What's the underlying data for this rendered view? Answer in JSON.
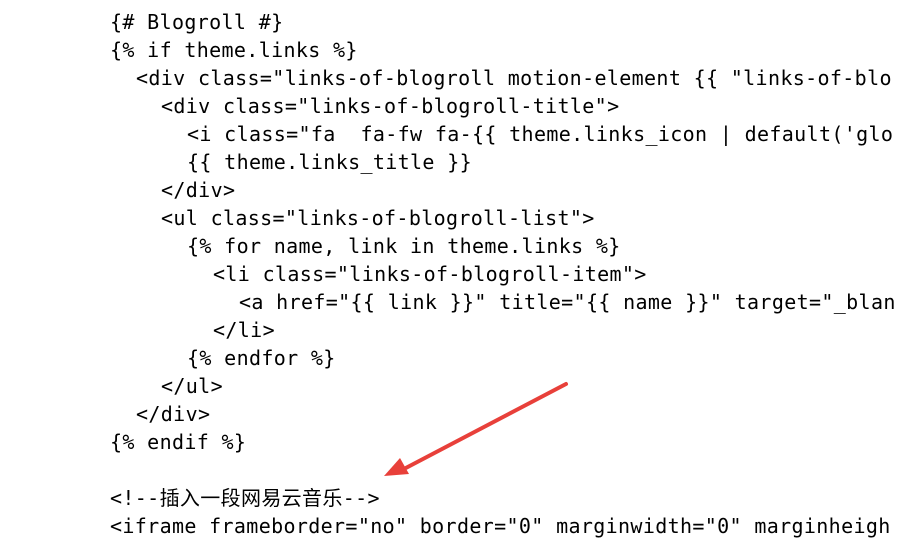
{
  "editor": {
    "lines": [
      {
        "indent": 0,
        "text": "{# Blogroll #}"
      },
      {
        "indent": 0,
        "text": "{% if theme.links %}"
      },
      {
        "indent": 1,
        "text": "<div class=\"links-of-blogroll motion-element {{ \"links-of-blo"
      },
      {
        "indent": 2,
        "text": "<div class=\"links-of-blogroll-title\">"
      },
      {
        "indent": 3,
        "text": "<i class=\"fa  fa-fw fa-{{ theme.links_icon | default('glo"
      },
      {
        "indent": 3,
        "text": "{{ theme.links_title }}"
      },
      {
        "indent": 2,
        "text": "</div>"
      },
      {
        "indent": 2,
        "text": "<ul class=\"links-of-blogroll-list\">"
      },
      {
        "indent": 3,
        "text": "{% for name, link in theme.links %}"
      },
      {
        "indent": 4,
        "text": "<li class=\"links-of-blogroll-item\">"
      },
      {
        "indent": 5,
        "text": "<a href=\"{{ link }}\" title=\"{{ name }}\" target=\"_blan"
      },
      {
        "indent": 4,
        "text": "</li>"
      },
      {
        "indent": 3,
        "text": "{% endfor %}"
      },
      {
        "indent": 2,
        "text": "</ul>"
      },
      {
        "indent": 1,
        "text": "</div>"
      },
      {
        "indent": 0,
        "text": "{% endif %}"
      },
      {
        "indent": 0,
        "text": ""
      },
      {
        "indent": 0,
        "text": "<!--插入一段网易云音乐-->"
      },
      {
        "indent": 0,
        "text": "<iframe frameborder=\"no\" border=\"0\" marginwidth=\"0\" marginheigh"
      }
    ]
  },
  "annotation": {
    "arrow_color": "#e8403a"
  }
}
